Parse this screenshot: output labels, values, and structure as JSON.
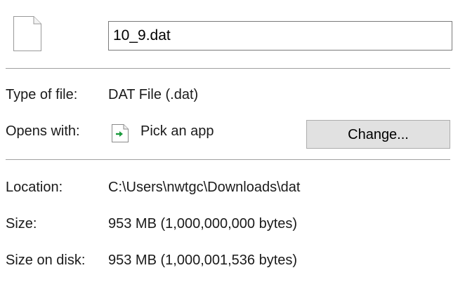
{
  "file": {
    "icon": "blank-document-icon",
    "name": "10_9.dat"
  },
  "type_of_file": {
    "label": "Type of file:",
    "value": "DAT File (.dat)"
  },
  "opens_with": {
    "label": "Opens with:",
    "app_icon": "pick-app-icon",
    "app_name": "Pick an app",
    "change_label": "Change..."
  },
  "location": {
    "label": "Location:",
    "value": "C:\\Users\\nwtgc\\Downloads\\dat"
  },
  "size": {
    "label": "Size:",
    "value": "953 MB (1,000,000,000 bytes)"
  },
  "size_on_disk": {
    "label": "Size on disk:",
    "value": "953 MB (1,000,001,536 bytes)"
  },
  "colors": {
    "button_bg": "#e1e1e1",
    "divider": "#a0a0a0",
    "arrow_green": "#1a9a3c"
  }
}
